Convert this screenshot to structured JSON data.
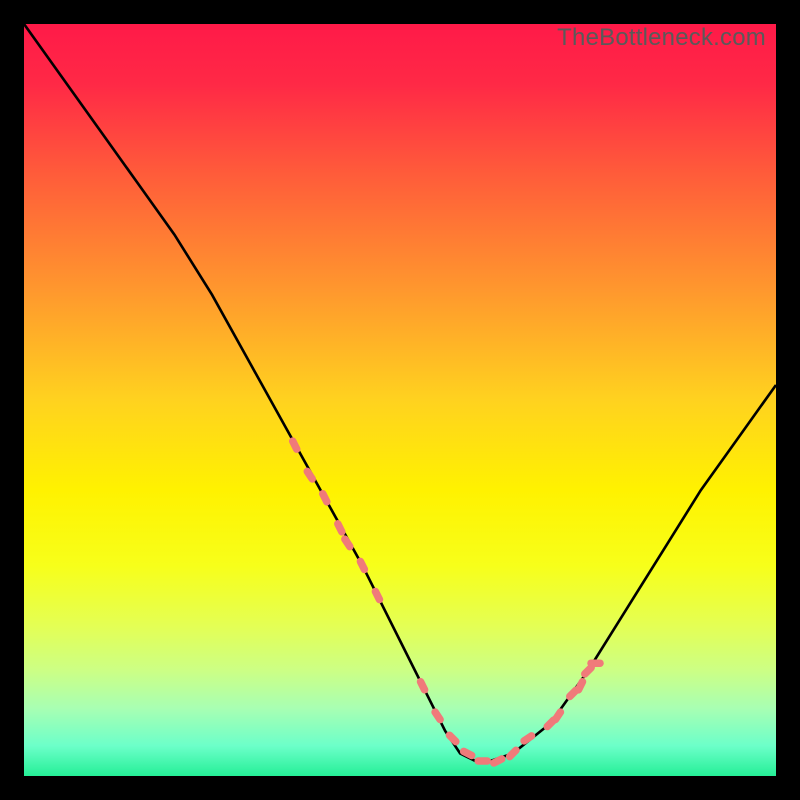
{
  "watermark": "TheBottleneck.com",
  "colors": {
    "gradient_stops": [
      {
        "offset": 0.0,
        "color": "#ff1a48"
      },
      {
        "offset": 0.08,
        "color": "#ff2946"
      },
      {
        "offset": 0.2,
        "color": "#ff5c3a"
      },
      {
        "offset": 0.35,
        "color": "#ff962e"
      },
      {
        "offset": 0.5,
        "color": "#ffd21f"
      },
      {
        "offset": 0.62,
        "color": "#fff200"
      },
      {
        "offset": 0.72,
        "color": "#f7ff1a"
      },
      {
        "offset": 0.8,
        "color": "#e4ff54"
      },
      {
        "offset": 0.86,
        "color": "#ccff85"
      },
      {
        "offset": 0.91,
        "color": "#a8ffb3"
      },
      {
        "offset": 0.96,
        "color": "#6cffc9"
      },
      {
        "offset": 1.0,
        "color": "#25ef97"
      }
    ],
    "curve_stroke": "#000000",
    "marker_fill": "#f07a7a"
  },
  "chart_data": {
    "type": "line",
    "title": "",
    "xlabel": "",
    "ylabel": "",
    "xlim": [
      0,
      100
    ],
    "ylim": [
      0,
      100
    ],
    "series": [
      {
        "name": "bottleneck-curve",
        "x": [
          0,
          5,
          10,
          15,
          20,
          25,
          30,
          35,
          40,
          45,
          50,
          55,
          56,
          58,
          60,
          62,
          65,
          70,
          75,
          80,
          85,
          90,
          95,
          100
        ],
        "values": [
          100,
          93,
          86,
          79,
          72,
          64,
          55,
          46,
          37,
          28,
          18,
          8,
          6,
          3,
          2,
          2,
          3,
          7,
          14,
          22,
          30,
          38,
          45,
          52
        ]
      }
    ],
    "markers": {
      "name": "highlighted-points",
      "x": [
        36,
        38,
        40,
        42,
        43,
        45,
        47,
        53,
        55,
        57,
        59,
        61,
        63,
        65,
        67,
        70,
        71,
        73,
        74,
        75,
        76
      ],
      "values": [
        44,
        40,
        37,
        33,
        31,
        28,
        24,
        12,
        8,
        5,
        3,
        2,
        2,
        3,
        5,
        7,
        8,
        11,
        12,
        14,
        15
      ]
    }
  }
}
